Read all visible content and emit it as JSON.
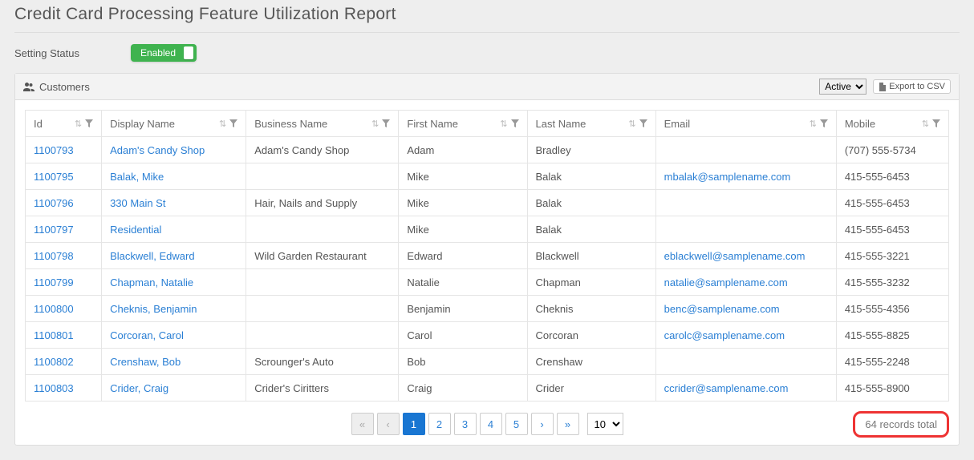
{
  "page": {
    "title": "Credit Card Processing Feature Utilization Report",
    "status_label": "Setting Status",
    "toggle_label": "Enabled"
  },
  "panel": {
    "title": "Customers",
    "filter_options": [
      "Active"
    ],
    "filter_selected": "Active",
    "export_label": "Export to CSV"
  },
  "columns": {
    "id": "Id",
    "display_name": "Display Name",
    "business_name": "Business Name",
    "first_name": "First Name",
    "last_name": "Last Name",
    "email": "Email",
    "mobile": "Mobile"
  },
  "rows": [
    {
      "id": "1100793",
      "display_name": "Adam's Candy Shop",
      "business_name": "Adam's Candy Shop",
      "first_name": "Adam",
      "last_name": "Bradley",
      "email": "",
      "mobile": "(707) 555-5734"
    },
    {
      "id": "1100795",
      "display_name": "Balak, Mike",
      "business_name": "",
      "first_name": "Mike",
      "last_name": "Balak",
      "email": "mbalak@samplename.com",
      "mobile": "415-555-6453"
    },
    {
      "id": "1100796",
      "display_name": "330 Main St",
      "business_name": "Hair, Nails and Supply",
      "first_name": "Mike",
      "last_name": "Balak",
      "email": "",
      "mobile": "415-555-6453"
    },
    {
      "id": "1100797",
      "display_name": "Residential",
      "business_name": "",
      "first_name": "Mike",
      "last_name": "Balak",
      "email": "",
      "mobile": "415-555-6453"
    },
    {
      "id": "1100798",
      "display_name": "Blackwell, Edward",
      "business_name": "Wild Garden Restaurant",
      "first_name": "Edward",
      "last_name": "Blackwell",
      "email": "eblackwell@samplename.com",
      "mobile": "415-555-3221"
    },
    {
      "id": "1100799",
      "display_name": "Chapman, Natalie",
      "business_name": "",
      "first_name": "Natalie",
      "last_name": "Chapman",
      "email": "natalie@samplename.com",
      "mobile": "415-555-3232"
    },
    {
      "id": "1100800",
      "display_name": "Cheknis, Benjamin",
      "business_name": "",
      "first_name": "Benjamin",
      "last_name": "Cheknis",
      "email": "benc@samplename.com",
      "mobile": "415-555-4356"
    },
    {
      "id": "1100801",
      "display_name": "Corcoran, Carol",
      "business_name": "",
      "first_name": "Carol",
      "last_name": "Corcoran",
      "email": "carolc@samplename.com",
      "mobile": "415-555-8825"
    },
    {
      "id": "1100802",
      "display_name": "Crenshaw, Bob",
      "business_name": "Scrounger's Auto",
      "first_name": "Bob",
      "last_name": "Crenshaw",
      "email": "",
      "mobile": "415-555-2248"
    },
    {
      "id": "1100803",
      "display_name": "Crider, Craig",
      "business_name": "Crider's Ciritters",
      "first_name": "Craig",
      "last_name": "Crider",
      "email": "ccrider@samplename.com",
      "mobile": "415-555-8900"
    }
  ],
  "pager": {
    "first": "«",
    "prev": "‹",
    "pages": [
      "1",
      "2",
      "3",
      "4",
      "5"
    ],
    "active_page": "1",
    "next": "›",
    "last": "»",
    "page_size": "10",
    "records_total": "64 records total"
  }
}
